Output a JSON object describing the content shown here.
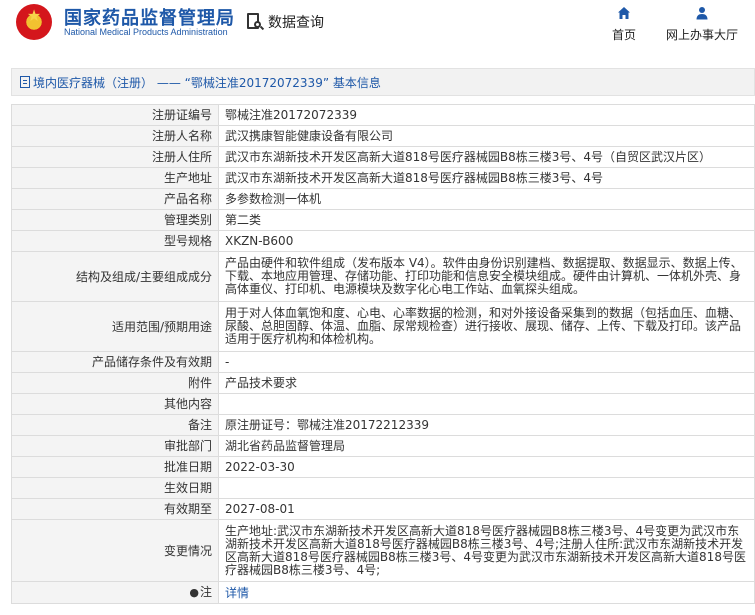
{
  "header": {
    "site_name_cn": "国家药品监督管理局",
    "site_name_en": "National Medical Products Administration",
    "search_label": "数据查询",
    "nav": [
      {
        "label": "首页",
        "icon": "home-icon"
      },
      {
        "label": "网上办事大厅",
        "icon": "user-icon"
      }
    ]
  },
  "breadcrumb": {
    "text": "境内医疗器械（注册） —— “鄂械注准20172072339” 基本信息"
  },
  "record": {
    "rows": [
      {
        "key": "注册证编号",
        "value": "鄂械注准20172072339"
      },
      {
        "key": "注册人名称",
        "value": "武汉携康智能健康设备有限公司"
      },
      {
        "key": "注册人住所",
        "value": "武汉市东湖新技术开发区高新大道818号医疗器械园B8栋三楼3号、4号（自贸区武汉片区）"
      },
      {
        "key": "生产地址",
        "value": "武汉市东湖新技术开发区高新大道818号医疗器械园B8栋三楼3号、4号"
      },
      {
        "key": "产品名称",
        "value": "多参数检测一体机"
      },
      {
        "key": "管理类别",
        "value": "第二类"
      },
      {
        "key": "型号规格",
        "value": "XKZN-B600"
      },
      {
        "key": "结构及组成/主要组成成分",
        "value": "产品由硬件和软件组成（发布版本 V4）。软件由身份识别建档、数据提取、数据显示、数据上传、下载、本地应用管理、存储功能、打印功能和信息安全模块组成。硬件由计算机、一体机外壳、身高体重仪、打印机、电源模块及数字化心电工作站、血氧探头组成。"
      },
      {
        "key": "适用范围/预期用途",
        "value": "用于对人体血氧饱和度、心电、心率数据的检测，和对外接设备采集到的数据（包括血压、血糖、尿酸、总胆固醇、体温、血脂、尿常规检查）进行接收、展现、储存、上传、下载及打印。该产品适用于医疗机构和体检机构。"
      },
      {
        "key": "产品储存条件及有效期",
        "value": "-"
      },
      {
        "key": "附件",
        "value": "产品技术要求"
      },
      {
        "key": "其他内容",
        "value": ""
      },
      {
        "key": "备注",
        "value": "原注册证号：鄂械注准20172212339"
      },
      {
        "key": "审批部门",
        "value": "湖北省药品监督管理局"
      },
      {
        "key": "批准日期",
        "value": "2022-03-30"
      },
      {
        "key": "生效日期",
        "value": ""
      },
      {
        "key": "有效期至",
        "value": "2027-08-01"
      },
      {
        "key": "变更情况",
        "value": "生产地址:武汉市东湖新技术开发区高新大道818号医疗器械园B8栋三楼3号、4号变更为武汉市东湖新技术开发区高新大道818号医疗器械园B8栋三楼3号、4号;注册人住所:武汉市东湖新技术开发区高新大道818号医疗器械园B8栋三楼3号、4号变更为武汉市东湖新技术开发区高新大道818号医疗器械园B8栋三楼3号、4号;"
      }
    ],
    "note_key": "注",
    "note_icon": "pin-icon",
    "note_link": "详情"
  },
  "colors": {
    "brand_blue": "#1e58a8",
    "key_bg": "#f4f4f4",
    "border": "#dcdcdc"
  }
}
